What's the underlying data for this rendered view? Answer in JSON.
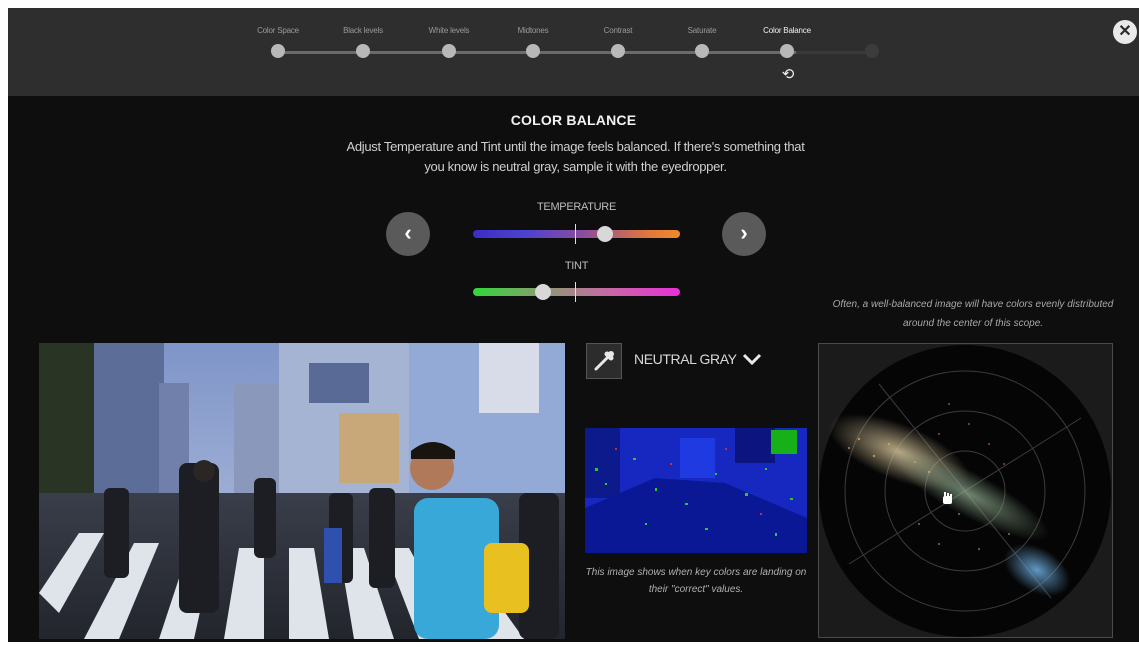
{
  "steps": [
    {
      "label": "Color Space",
      "state": "done"
    },
    {
      "label": "Black levels",
      "state": "done"
    },
    {
      "label": "White levels",
      "state": "done"
    },
    {
      "label": "Midtones",
      "state": "done"
    },
    {
      "label": "Contrast",
      "state": "done"
    },
    {
      "label": "Saturate",
      "state": "done"
    },
    {
      "label": "Color Balance",
      "state": "active"
    }
  ],
  "icons": {
    "reset": "undo-icon",
    "close": "close-icon",
    "prev": "chevron-left-icon",
    "next": "chevron-right-icon",
    "eyedropper": "eyedropper-icon",
    "dropdown": "chevron-down-icon",
    "cursor": "hand-cursor-icon"
  },
  "symbols": {
    "reset": "⟲",
    "close": "✕",
    "prev": "‹",
    "next": "›"
  },
  "main": {
    "title": "COLOR BALANCE",
    "description": "Adjust Temperature and Tint until the image feels balanced. If there's something that you know is neutral gray, sample it with the eyedropper."
  },
  "sliders": {
    "temperature": {
      "label": "TEMPERATURE",
      "position": 0.64
    },
    "tint": {
      "label": "TINT",
      "position": 0.34
    }
  },
  "scope": {
    "note": "Often, a well-balanced image will have colors evenly distributed around the center of this scope."
  },
  "neutral_gray": {
    "label": "NEUTRAL GRAY"
  },
  "false_color": {
    "caption": "This image shows when key colors are landing on their \"correct\" values."
  },
  "colors": {
    "background": "#0e0e0e",
    "topbar": "#2e2e2e",
    "step_dot": "#b8b8b8",
    "nav_button": "#5a5a5a",
    "false_color_blue": "#1830c8",
    "photo_sky": "#8aa0d0"
  }
}
